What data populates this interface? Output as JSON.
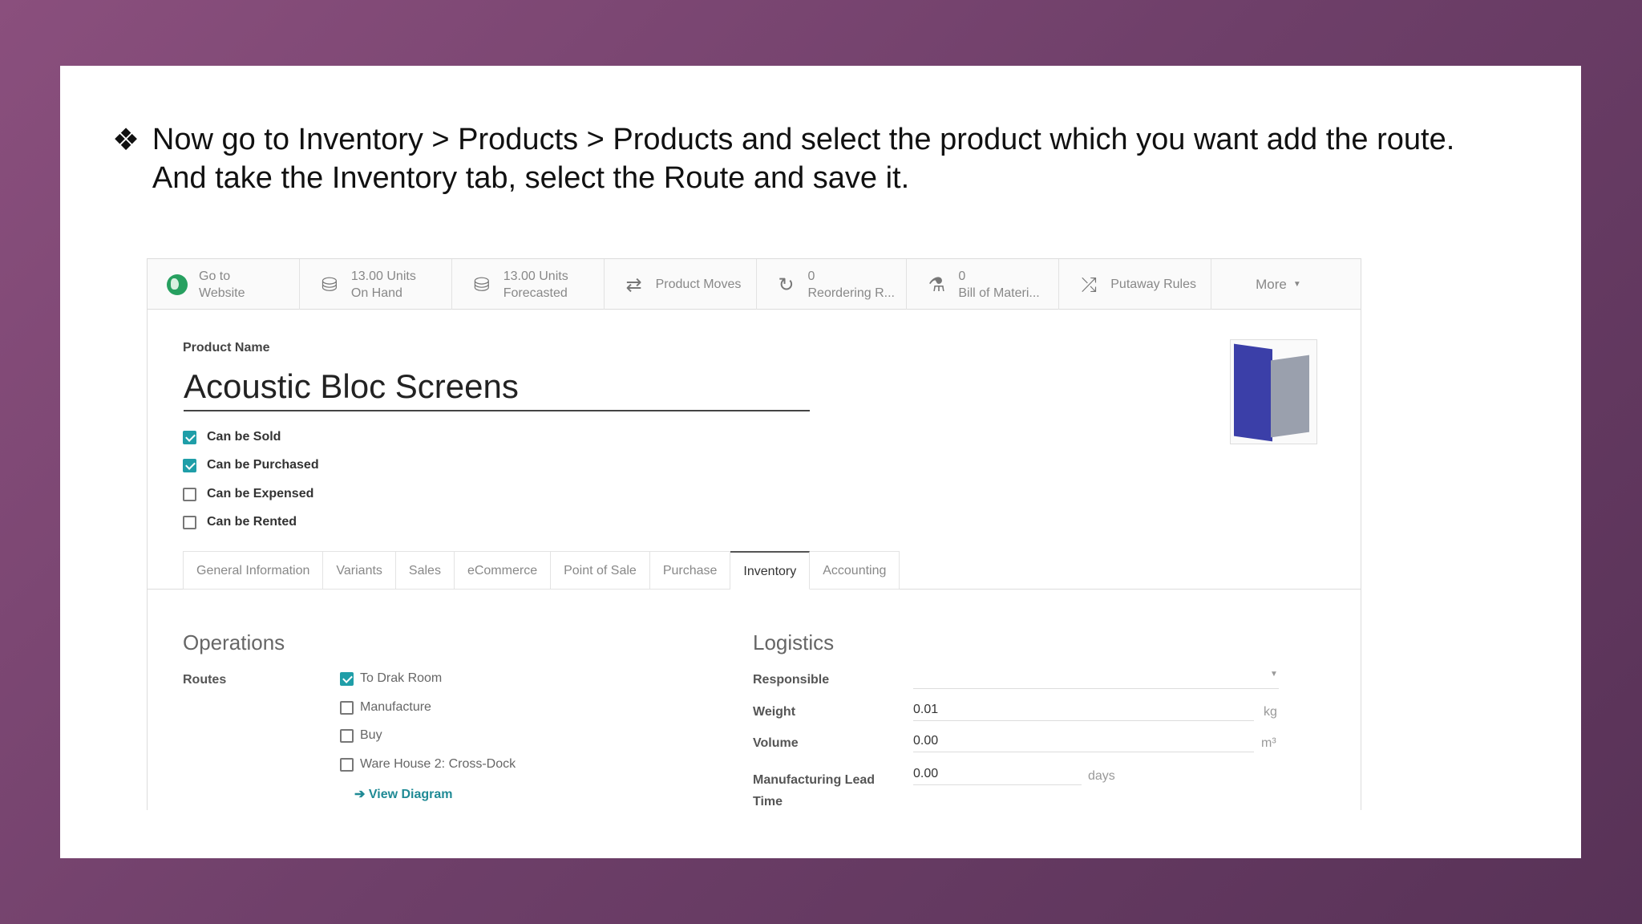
{
  "slide": {
    "bullet_glyph": "❖",
    "instruction": "Now go to Inventory > Products > Products and select the product which you want add the route. And take the Inventory tab, select the Route and save it."
  },
  "smart_buttons": [
    {
      "line1": "Go to",
      "line2": "Website",
      "icon": "globe-icon"
    },
    {
      "line1": "13.00 Units",
      "line2": "On Hand",
      "icon": "cubes-icon"
    },
    {
      "line1": "13.00 Units",
      "line2": "Forecasted",
      "icon": "cubes-icon"
    },
    {
      "line1": "Product Moves",
      "line2": "",
      "icon": "exchange-arrows-icon"
    },
    {
      "line1": "0",
      "line2": "Reordering R...",
      "icon": "refresh-icon"
    },
    {
      "line1": "0",
      "line2": "Bill of Materi...",
      "icon": "flask-icon"
    },
    {
      "line1": "Putaway Rules",
      "line2": "",
      "icon": "shuffle-icon"
    },
    {
      "label": "More",
      "icon": "caret-down-icon"
    }
  ],
  "product": {
    "name_label": "Product Name",
    "name": "Acoustic Bloc Screens",
    "image_icon": "product-image"
  },
  "flags": [
    {
      "label": "Can be Sold",
      "checked": true
    },
    {
      "label": "Can be Purchased",
      "checked": true
    },
    {
      "label": "Can be Expensed",
      "checked": false
    },
    {
      "label": "Can be Rented",
      "checked": false
    }
  ],
  "tabs": [
    "General Information",
    "Variants",
    "Sales",
    "eCommerce",
    "Point of Sale",
    "Purchase",
    "Inventory",
    "Accounting"
  ],
  "active_tab": "Inventory",
  "operations": {
    "title": "Operations",
    "routes_label": "Routes",
    "routes": [
      {
        "label": "To Drak Room",
        "checked": true
      },
      {
        "label": "Manufacture",
        "checked": false
      },
      {
        "label": "Buy",
        "checked": false
      },
      {
        "label": "Ware House 2: Cross-Dock",
        "checked": false
      }
    ],
    "view_diagram": "View Diagram"
  },
  "logistics": {
    "title": "Logistics",
    "responsible_label": "Responsible",
    "responsible_value": "",
    "weight_label": "Weight",
    "weight_value": "0.01",
    "weight_unit": "kg",
    "volume_label": "Volume",
    "volume_value": "0.00",
    "volume_unit": "m³",
    "lead_label_1": "Manufacturing Lead",
    "lead_label_2": "Time",
    "lead_value": "0.00",
    "lead_unit": "days"
  },
  "colors": {
    "accent": "#1f9ea8",
    "link": "#1f8a95",
    "website_icon": "#27a060"
  }
}
